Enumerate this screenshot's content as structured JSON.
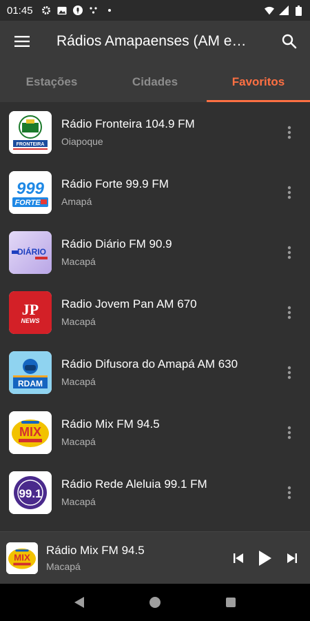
{
  "status_bar": {
    "time": "01:45",
    "icons": [
      "settings-icon",
      "photo-icon",
      "voice-icon",
      "dots-icon",
      "dot-icon"
    ],
    "right_icons": [
      "wifi-icon",
      "signal-icon",
      "battery-icon"
    ]
  },
  "app_bar": {
    "title": "Rádios Amapaenses (AM e…",
    "menu_icon": "hamburger-menu-icon",
    "search_icon": "search-icon"
  },
  "tabs": [
    {
      "label": "Estações",
      "active": false
    },
    {
      "label": "Cidades",
      "active": false
    },
    {
      "label": "Favoritos",
      "active": true
    }
  ],
  "stations": [
    {
      "name": "Rádio Fronteira 104.9 FM",
      "city": "Oiapoque",
      "logo": "fronteira-logo"
    },
    {
      "name": "Rádio Forte 99.9 FM",
      "city": "Amapá",
      "logo": "forte-logo"
    },
    {
      "name": "Rádio Diário FM 90.9",
      "city": "Macapá",
      "logo": "diario-logo"
    },
    {
      "name": "Radio Jovem Pan AM 670",
      "city": "Macapá",
      "logo": "jovem-pan-logo"
    },
    {
      "name": "Rádio Difusora do Amapá AM 630",
      "city": "Macapá",
      "logo": "difusora-logo"
    },
    {
      "name": "Rádio Mix FM 94.5",
      "city": "Macapá",
      "logo": "mix-logo"
    },
    {
      "name": "Rádio Rede Aleluia 99.1 FM",
      "city": "Macapá",
      "logo": "aleluia-logo"
    }
  ],
  "logo_text": {
    "fronteira": "FRONTEIRA",
    "forte_num": "999",
    "forte_word": "FORTE",
    "diario": "DIÁRIO",
    "jp_letters": "JP",
    "jp_news": "NEWS",
    "difusora": "RDAM",
    "mix": "MIX",
    "aleluia": "99.1"
  },
  "player": {
    "name": "Rádio Mix FM 94.5",
    "city": "Macapá",
    "controls": [
      "skip-previous-icon",
      "play-icon",
      "skip-next-icon"
    ]
  },
  "colors": {
    "accent": "#ff7043",
    "background": "#303030",
    "app_bar": "#3a3a3a"
  }
}
